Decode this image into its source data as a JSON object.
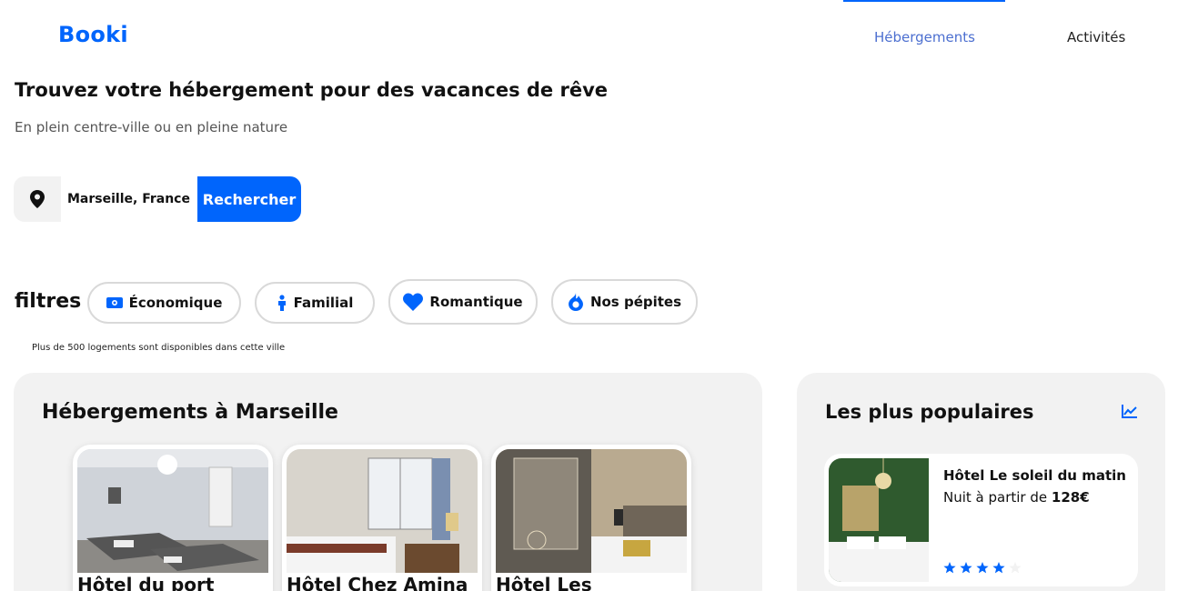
{
  "brand": {
    "logo_text": "Booki",
    "accent": "#0065fc"
  },
  "nav": {
    "items": [
      {
        "label": "Hébergements",
        "active": true
      },
      {
        "label": "Activités",
        "active": false
      }
    ]
  },
  "hero": {
    "title": "Trouvez votre hébergement pour des vacances de rêve",
    "subtitle": "En plein centre-ville ou en pleine nature"
  },
  "search": {
    "icon": "location-pin-icon",
    "value": "Marseille, France",
    "button_label": "Rechercher"
  },
  "filters": {
    "label": "filtres",
    "items": [
      {
        "label": "Économique",
        "icon": "money-icon"
      },
      {
        "label": "Familial",
        "icon": "person-icon"
      },
      {
        "label": "Romantique",
        "icon": "heart-icon"
      },
      {
        "label": "Nos pépites",
        "icon": "fire-icon"
      }
    ]
  },
  "info": {
    "text": "Plus de 500 logements sont disponibles dans cette ville"
  },
  "listings": {
    "title": "Hébergements à Marseille",
    "cards": [
      {
        "name": "Hôtel du port"
      },
      {
        "name": "Hôtel Chez Amina"
      },
      {
        "name": "Hôtel Les"
      }
    ]
  },
  "popular": {
    "title": "Les plus populaires",
    "icon": "trend-chart-icon",
    "items": [
      {
        "name": "Hôtel Le soleil du matin",
        "price_prefix": "Nuit à partir de ",
        "price": "128€",
        "rating": 4,
        "rating_max": 5
      }
    ]
  }
}
